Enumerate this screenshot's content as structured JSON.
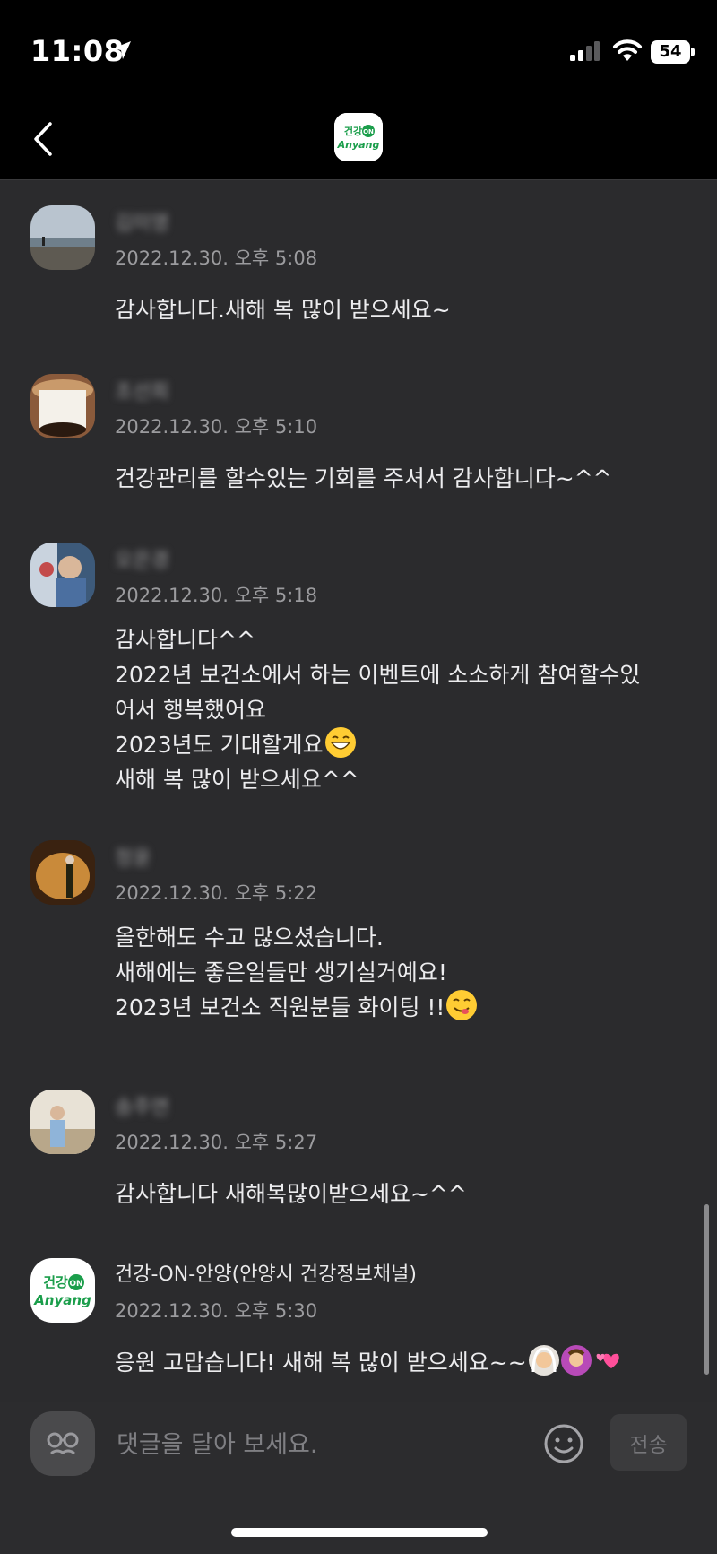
{
  "status_bar": {
    "time": "11:08",
    "battery": "54"
  },
  "nav": {
    "logo_text_top": "건강",
    "logo_badge": "ON",
    "logo_text_bottom": "Anyang"
  },
  "comments": [
    {
      "name": "김미영",
      "date": "2022.12.30. 오후 5:08",
      "lines": [
        "감사합니다.새해 복 많이 받으세요~"
      ]
    },
    {
      "name": "조선희",
      "date": "2022.12.30. 오후 5:10",
      "lines": [
        "건강관리를 할수있는 기회를 주셔서 감사합니다~^^"
      ]
    },
    {
      "name": "오은경",
      "date": "2022.12.30. 오후 5:18",
      "lines": [
        "감사합니다^^",
        "2022년 보건소에서 하는 이벤트에 소소하게 참여할수있",
        "어서 행복했어요",
        "2023년도 기대할게요",
        "새해 복 많이 받으세요^^"
      ]
    },
    {
      "name": "정윤",
      "date": "2022.12.30. 오후 5:22",
      "lines": [
        "올한해도 수고 많으셨습니다.",
        "새해에는  좋은일들만 생기실거예요!",
        "2023년 보건소 직원분들 화이팅 !!"
      ]
    },
    {
      "name": "송주연",
      "date": "2022.12.30. 오후 5:27",
      "lines": [
        "감사합니다 새해복많이받으세요~^^"
      ]
    },
    {
      "name": "건강-ON-안양(안양시 건강정보채널)",
      "date": "2022.12.30. 오후 5:30",
      "lines": [
        "응원 고맙습니다! 새해 복 많이 받으세요~~"
      ]
    }
  ],
  "input": {
    "placeholder": "댓글을 달아 보세요.",
    "send_label": "전송"
  }
}
